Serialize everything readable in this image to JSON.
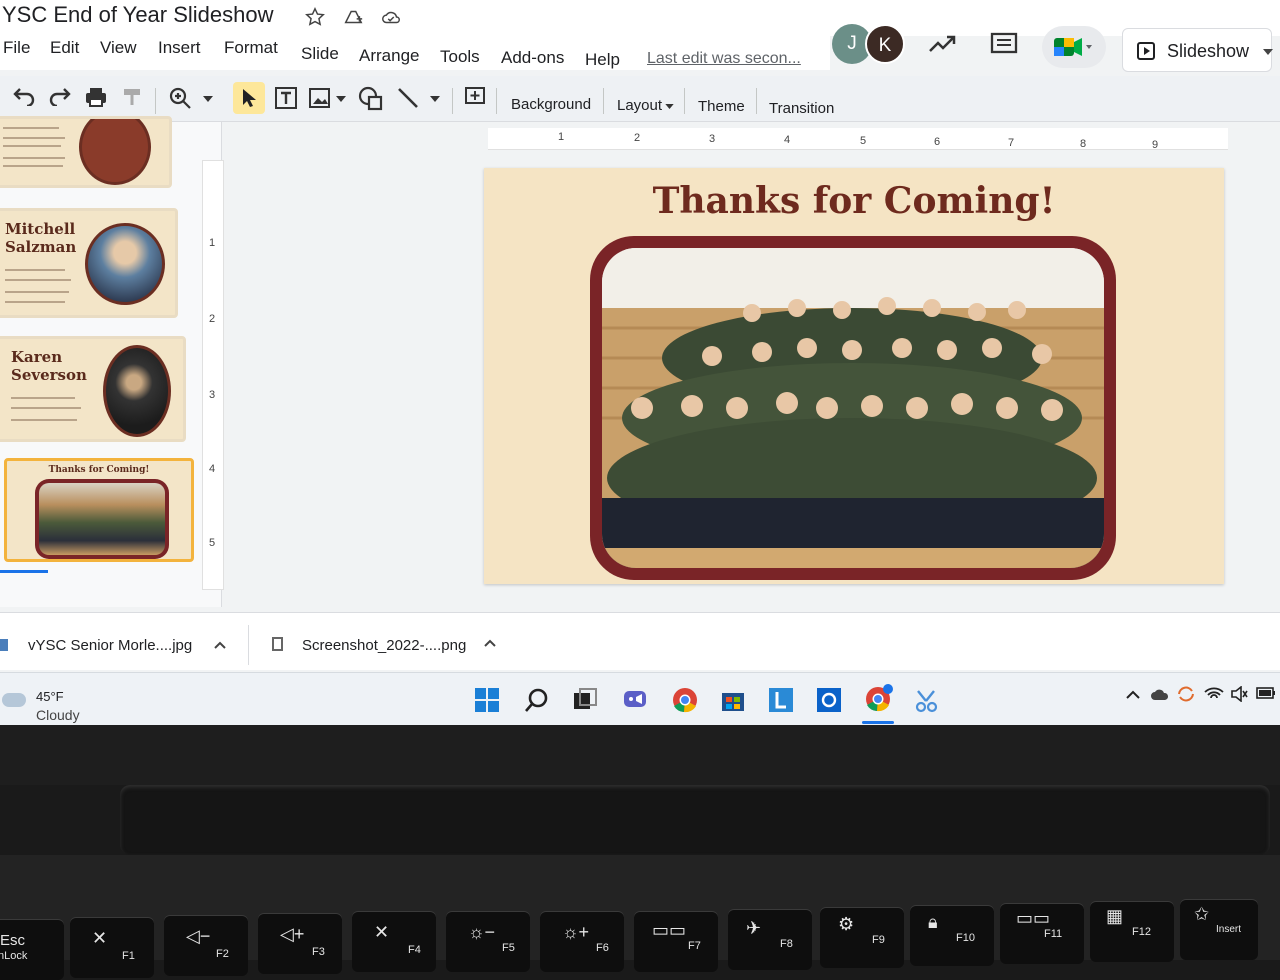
{
  "app": {
    "doc_title": "YSC End of Year Slideshow",
    "last_edit": "Last edit was secon...",
    "avatars": [
      "J",
      "K"
    ],
    "slideshow_label": "Slideshow"
  },
  "menu": [
    "File",
    "Edit",
    "View",
    "Insert",
    "Format",
    "Slide",
    "Arrange",
    "Tools",
    "Add-ons",
    "Help"
  ],
  "toolbar": {
    "background": "Background",
    "layout": "Layout",
    "theme": "Theme",
    "transition": "Transition"
  },
  "ruler": {
    "horizontal": [
      "1",
      "2",
      "3",
      "4",
      "5",
      "6",
      "7",
      "8",
      "9"
    ],
    "vertical": [
      "1",
      "2",
      "3",
      "4",
      "5"
    ]
  },
  "filmstrip": {
    "thumbs": [
      {
        "name_line1": "",
        "name_line2": ""
      },
      {
        "name_line1": "Mitchell",
        "name_line2": "Salzman"
      },
      {
        "name_line1": "Karen",
        "name_line2": "Severson"
      },
      {
        "title": "Thanks for Coming!"
      }
    ]
  },
  "slide": {
    "title": "Thanks for Coming!"
  },
  "downloads": [
    {
      "name": "vYSC Senior Morle....jpg"
    },
    {
      "name": "Screenshot_2022-....png"
    }
  ],
  "taskbar": {
    "temp": "45°F",
    "weather": "Cloudy"
  },
  "keyboard": {
    "keys": [
      "Esc",
      "F1",
      "F2",
      "F3",
      "F4",
      "F5",
      "F6",
      "F7",
      "F8",
      "F9",
      "F10",
      "F11",
      "F12",
      "Insert"
    ],
    "esc_sub": "nLock"
  },
  "colors": {
    "slide_bg": "#f5e4c4",
    "slide_title": "#6e2a1e",
    "frame": "#7a2427",
    "selected_thumb": "#f3b33d"
  }
}
